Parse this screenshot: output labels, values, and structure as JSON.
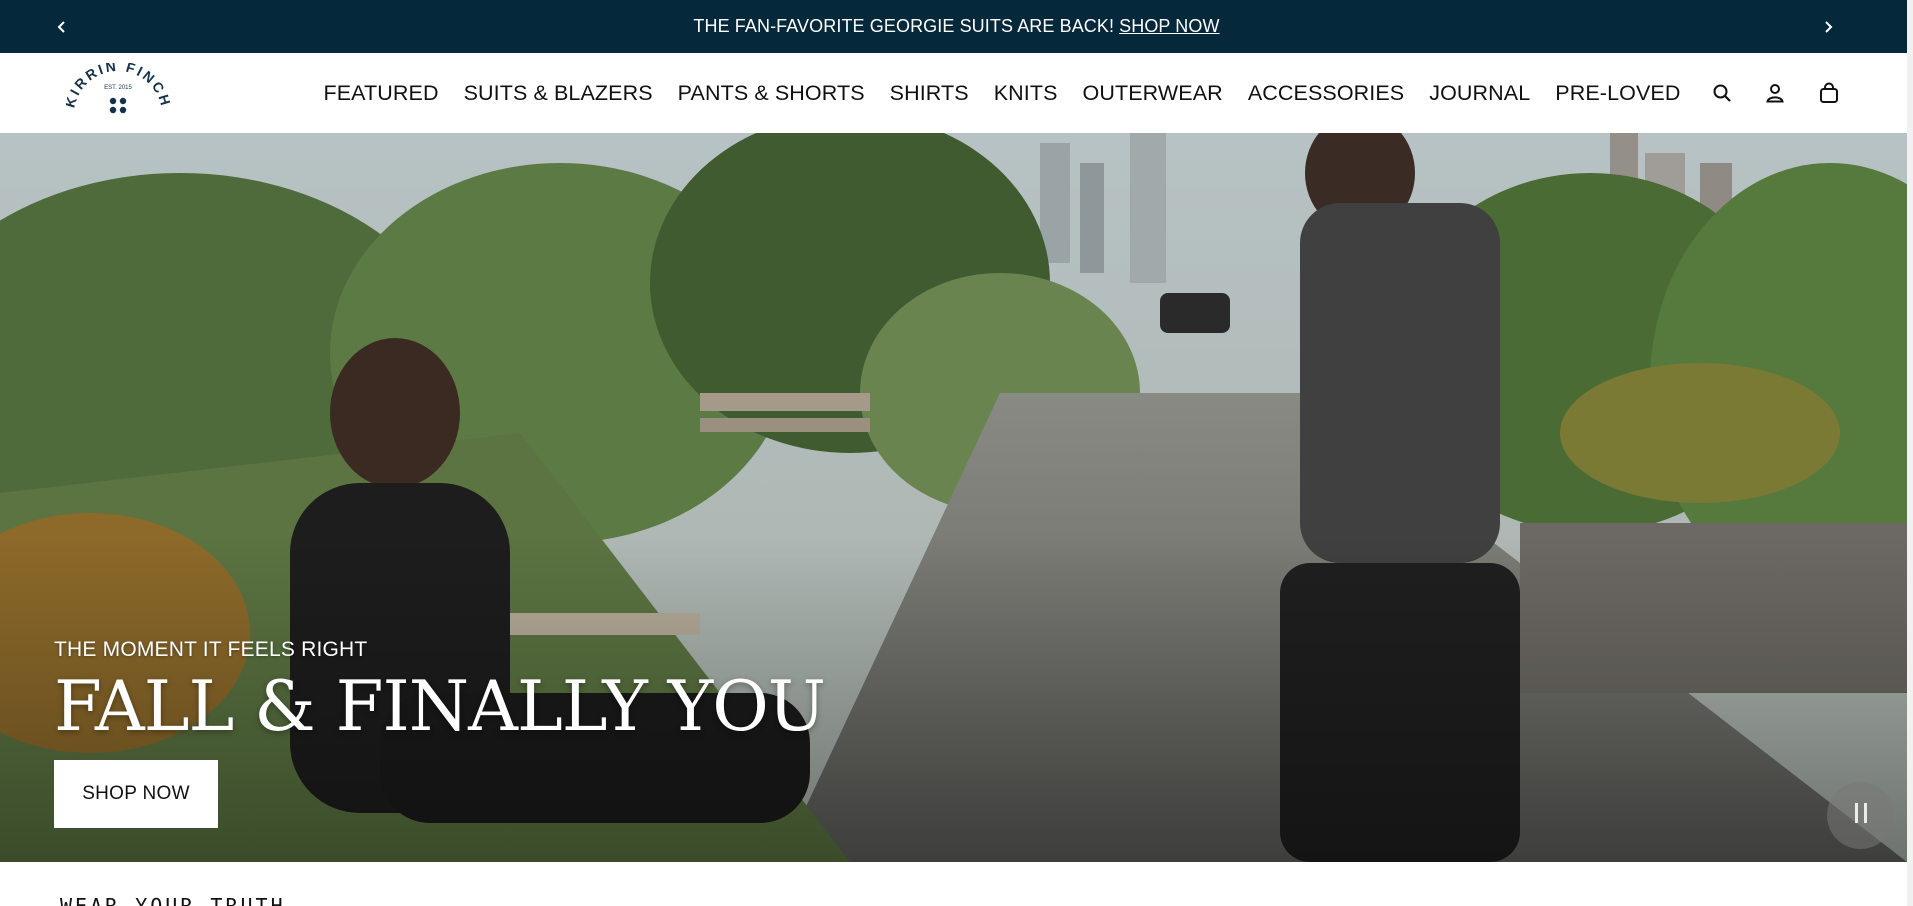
{
  "announcement": {
    "text": "THE FAN-FAVORITE GEORGIE SUITS ARE BACK!",
    "link_label": "SHOP NOW",
    "prev_icon": "chevron-left-icon",
    "next_icon": "chevron-right-icon",
    "background": "#05283a"
  },
  "header": {
    "logo": {
      "brand_text": "KIRRIN FINCH",
      "est_text": "EST. 2015"
    },
    "nav": [
      {
        "label": "FEATURED"
      },
      {
        "label": "SUITS & BLAZERS"
      },
      {
        "label": "PANTS & SHORTS"
      },
      {
        "label": "SHIRTS"
      },
      {
        "label": "KNITS"
      },
      {
        "label": "OUTERWEAR"
      },
      {
        "label": "ACCESSORIES"
      },
      {
        "label": "JOURNAL"
      },
      {
        "label": "PRE-LOVED"
      }
    ],
    "icons": [
      "search-icon",
      "account-icon",
      "cart-icon"
    ]
  },
  "hero": {
    "eyebrow": "THE MOMENT IT FEELS RIGHT",
    "headline": "FALL & FINALLY YOU",
    "cta_label": "SHOP NOW",
    "pause_icon": "pause-icon"
  },
  "section": {
    "title": "WEAR YOUR TRUTH"
  }
}
